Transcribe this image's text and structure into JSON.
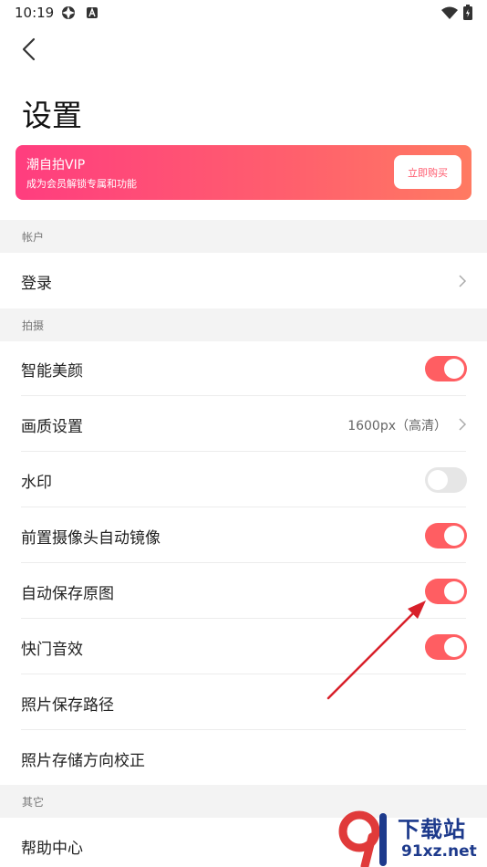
{
  "status_bar": {
    "time": "10:19"
  },
  "page": {
    "title": "设置"
  },
  "vip": {
    "title": "潮自拍VIP",
    "subtitle": "成为会员解锁专属和功能",
    "buy_label": "立即购买"
  },
  "sections": {
    "account": {
      "header": "帐户",
      "login_label": "登录"
    },
    "shooting": {
      "header": "拍摄",
      "smart_beauty_label": "智能美颜",
      "smart_beauty_on": true,
      "quality_label": "画质设置",
      "quality_value": "1600px（高清）",
      "watermark_label": "水印",
      "watermark_on": false,
      "front_mirror_label": "前置摄像头自动镜像",
      "front_mirror_on": true,
      "auto_save_label": "自动保存原图",
      "auto_save_on": true,
      "shutter_sound_label": "快门音效",
      "shutter_sound_on": true,
      "save_path_label": "照片保存路径",
      "orientation_label": "照片存储方向校正"
    },
    "other": {
      "header": "其它",
      "help_label": "帮助中心"
    }
  },
  "watermark": {
    "text": "下载站",
    "url": "91xz.net"
  },
  "colors": {
    "accent": "#ff5e62",
    "toggle_off": "#e6e6e6",
    "section_bg": "#f3f3f3",
    "annotation_arrow": "#d8202a"
  }
}
